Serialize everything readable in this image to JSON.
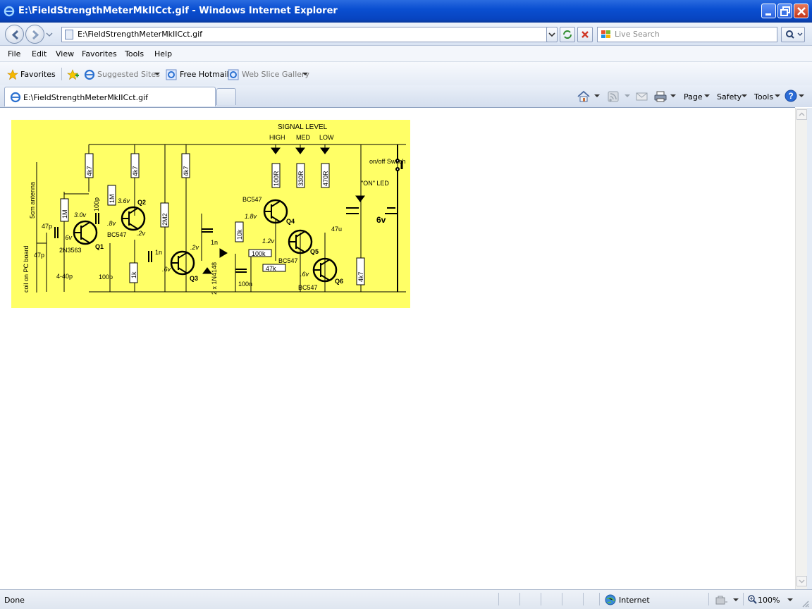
{
  "window": {
    "title": "E:\\FieldStrengthMeterMkIICct.gif - Windows Internet Explorer",
    "icon": "ie-logo-icon"
  },
  "address_bar": {
    "url": "E:\\FieldStrengthMeterMkIICct.gif",
    "search_placeholder": "Live Search"
  },
  "menu": [
    "File",
    "Edit",
    "View",
    "Favorites",
    "Tools",
    "Help"
  ],
  "favorites_bar": {
    "favorites_label": "Favorites",
    "items": [
      "Suggested Sites",
      "Free Hotmail",
      "Web Slice Gallery"
    ]
  },
  "tab": {
    "label": "E:\\FieldStrengthMeterMkIICct.gif"
  },
  "command_bar": {
    "page": "Page",
    "safety": "Safety",
    "tools": "Tools"
  },
  "status_bar": {
    "text": "Done",
    "zone": "Internet",
    "zoom": "100%"
  },
  "circuit": {
    "title": "SIGNAL LEVEL",
    "levels": [
      "HIGH",
      "MED",
      "LOW"
    ],
    "labels": {
      "antenna": "5cm antenna",
      "coil": "coil on PC board",
      "c47p_a": "47p",
      "c47p_b": "47p",
      "trimmer": "4-40p",
      "q1_type": "2N3563",
      "q1": "Q1",
      "q1_v": ".6v",
      "r1m_a": "1M",
      "r1m_b": "1M",
      "r4k7_a": "4k7",
      "r4k7_b": "4k7",
      "r4k7_c": "4k7",
      "r4k7_d": "4k7",
      "c100p_a": "100p",
      "c100p_b": "100p",
      "q2": "Q2",
      "q2_type": "BC547",
      "v30": "3.0v",
      "v36": "3.6v",
      "v8": ".8v",
      "v2a": ".2v",
      "r1k": "1k",
      "r2m2": "2M2",
      "c1n_a": "1n",
      "c1n_b": "1n",
      "v6a": ".6v",
      "v2b": ".2v",
      "q3": "Q3",
      "diode": "2 x 1N4148",
      "c100n": "100n",
      "r10k": "10k",
      "r100k": "100k",
      "r47k": "47k",
      "q4_type": "BC547",
      "v18": "1.8v",
      "q4": "Q4",
      "v12": "1.2v",
      "q5": "Q5",
      "q5_type": "BC547",
      "v6b": ".6v",
      "q6": "Q6",
      "q6_type": "BC547",
      "r100r": "100R",
      "r330r": "330R",
      "r470r": "470R",
      "c47u": "47u",
      "on_led": "\"ON\" LED",
      "switch": "on/off Switch",
      "battery": "6v"
    }
  }
}
